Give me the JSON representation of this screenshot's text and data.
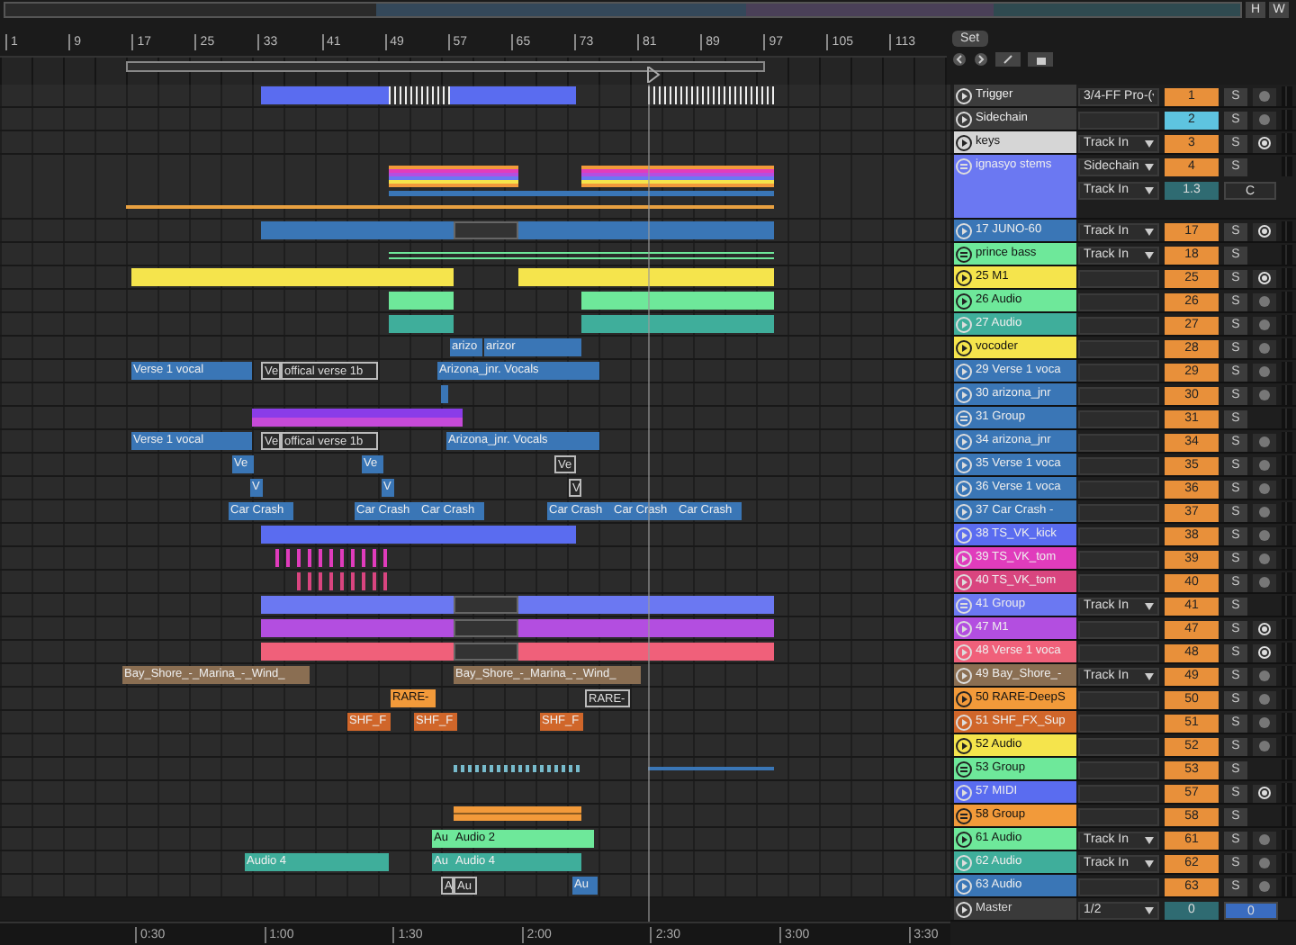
{
  "overview": {
    "buttons": [
      "H",
      "W"
    ]
  },
  "ruler": {
    "bars": [
      "1",
      "9",
      "17",
      "25",
      "33",
      "41",
      "49",
      "57",
      "65",
      "73",
      "81",
      "89",
      "97",
      "105",
      "113"
    ],
    "times": [
      "0:30",
      "1:00",
      "1:30",
      "2:00",
      "2:30",
      "3:00",
      "3:30"
    ]
  },
  "scene": {
    "button": "Set"
  },
  "tracks": [
    {
      "name": "Trigger",
      "kind": "track",
      "color": "#3c3c3c",
      "input": "3/4-FF Pro-(",
      "number": "1",
      "selected": false,
      "armed": false
    },
    {
      "name": "Sidechain",
      "kind": "track",
      "color": "#3c3c3c",
      "number": "2",
      "selected": true,
      "armed": false
    },
    {
      "name": "keys",
      "kind": "track",
      "color": "#d6d6d6",
      "input": "Track In",
      "number": "3",
      "selected": false,
      "armed": true
    },
    {
      "name": "ignasyo stems",
      "kind": "stems",
      "color": "#6b78f2",
      "input": "Sidechain",
      "number": "4",
      "selected": false,
      "sub_input": "Track In",
      "sub_value": "1.3",
      "sub_pan": "C"
    },
    {
      "name": "17 JUNO-60",
      "kind": "track",
      "color": "#3a76b6",
      "input": "Track In",
      "number": "17",
      "selected": false,
      "armed": true
    },
    {
      "name": "prince bass",
      "kind": "group",
      "color": "#6ee89a",
      "input": "Track In",
      "number": "18",
      "selected": false
    },
    {
      "name": "25 M1",
      "kind": "track",
      "color": "#f5e44c",
      "number": "25",
      "selected": false,
      "armed": true
    },
    {
      "name": "26 Audio",
      "kind": "track",
      "color": "#6ee89a",
      "number": "26",
      "selected": false,
      "armed": false
    },
    {
      "name": "27 Audio",
      "kind": "track",
      "color": "#3fae9b",
      "number": "27",
      "selected": false,
      "armed": false
    },
    {
      "name": "vocoder",
      "kind": "track",
      "color": "#f5e44c",
      "number": "28",
      "selected": false,
      "armed": false,
      "clips": [
        {
          "label": "arizo",
          "muted": false
        },
        {
          "label": "arizor",
          "muted": false
        }
      ]
    },
    {
      "name": "29 Verse 1 voca",
      "kind": "track",
      "color": "#3a76b6",
      "number": "29",
      "selected": false,
      "armed": false,
      "clips": [
        {
          "label": "Verse 1 vocal",
          "muted": false
        },
        {
          "label": "Ve",
          "muted": true
        },
        {
          "label": "offical verse 1b",
          "muted": true
        },
        {
          "label": "Arizona_jnr. Vocals",
          "muted": false
        }
      ]
    },
    {
      "name": "30 arizona_jnr",
      "kind": "track",
      "color": "#3a76b6",
      "number": "30",
      "selected": false,
      "armed": false
    },
    {
      "name": "31 Group",
      "kind": "group",
      "color": "#3a76b6",
      "number": "31",
      "selected": false
    },
    {
      "name": "34 arizona_jnr",
      "kind": "track",
      "color": "#3a76b6",
      "number": "34",
      "selected": false,
      "armed": false,
      "clips": [
        {
          "label": "Verse 1 vocal",
          "muted": false
        },
        {
          "label": "Ve",
          "muted": true
        },
        {
          "label": "offical verse 1b",
          "muted": true
        },
        {
          "label": "Arizona_jnr. Vocals",
          "muted": false
        }
      ]
    },
    {
      "name": "35 Verse 1 voca",
      "kind": "track",
      "color": "#3a76b6",
      "number": "35",
      "selected": false,
      "armed": false,
      "clips": [
        {
          "label": "Ve",
          "muted": false
        },
        {
          "label": "Ve",
          "muted": false
        },
        {
          "label": "Ve",
          "muted": true
        }
      ]
    },
    {
      "name": "36 Verse 1 voca",
      "kind": "track",
      "color": "#3a76b6",
      "number": "36",
      "selected": false,
      "armed": false,
      "clips": [
        {
          "label": "V",
          "muted": false
        },
        {
          "label": "V",
          "muted": false
        },
        {
          "label": "V",
          "muted": true
        }
      ]
    },
    {
      "name": "37 Car Crash -",
      "kind": "track",
      "color": "#3a76b6",
      "number": "37",
      "selected": false,
      "armed": false,
      "clips": [
        {
          "label": "Car Crash",
          "muted": false
        },
        {
          "label": "Car Crash",
          "muted": false
        },
        {
          "label": "Car Crash",
          "muted": false
        },
        {
          "label": "Car Crash",
          "muted": false
        },
        {
          "label": "Car Crash",
          "muted": false
        },
        {
          "label": "Car Crash",
          "muted": false
        }
      ]
    },
    {
      "name": "38 TS_VK_kick",
      "kind": "track",
      "color": "#5a6cf0",
      "number": "38",
      "selected": false,
      "armed": false
    },
    {
      "name": "39 TS_VK_tom",
      "kind": "track",
      "color": "#e03cbc",
      "number": "39",
      "selected": false,
      "armed": false
    },
    {
      "name": "40 TS_VK_tom",
      "kind": "track",
      "color": "#d9457f",
      "number": "40",
      "selected": false,
      "armed": false
    },
    {
      "name": "41 Group",
      "kind": "group",
      "color": "#6b78f2",
      "input": "Track In",
      "number": "41",
      "selected": false
    },
    {
      "name": "47 M1",
      "kind": "track",
      "color": "#b34ee0",
      "number": "47",
      "selected": false,
      "armed": true
    },
    {
      "name": "48 Verse 1 voca",
      "kind": "track",
      "color": "#f0607a",
      "number": "48",
      "selected": false,
      "armed": true
    },
    {
      "name": "49 Bay_Shore_-",
      "kind": "track",
      "color": "#8a6e52",
      "input": "Track In",
      "number": "49",
      "selected": false,
      "armed": false,
      "clips": [
        {
          "label": "Bay_Shore_-_Marina_-_Wind_",
          "muted": false
        },
        {
          "label": "Bay_Shore_-_Marina_-_Wind_",
          "muted": false
        }
      ]
    },
    {
      "name": "50 RARE-DeepS",
      "kind": "track",
      "color": "#f29a3a",
      "number": "50",
      "selected": false,
      "armed": false,
      "clips": [
        {
          "label": "RARE-",
          "muted": false
        },
        {
          "label": "RARE-",
          "muted": true
        }
      ]
    },
    {
      "name": "51 SHF_FX_Sup",
      "kind": "track",
      "color": "#d0662a",
      "number": "51",
      "selected": false,
      "armed": false,
      "clips": [
        {
          "label": "SHF_F",
          "muted": false
        },
        {
          "label": "SHF_F",
          "muted": false
        },
        {
          "label": "SHF_F",
          "muted": false
        }
      ]
    },
    {
      "name": "52 Audio",
      "kind": "track",
      "color": "#f5e44c",
      "number": "52",
      "selected": false,
      "armed": false
    },
    {
      "name": "53 Group",
      "kind": "group",
      "color": "#6ee89a",
      "number": "53",
      "selected": false
    },
    {
      "name": "57 MIDI",
      "kind": "track",
      "color": "#5a6cf0",
      "number": "57",
      "selected": false,
      "armed": true
    },
    {
      "name": "58 Group",
      "kind": "group",
      "color": "#f29a3a",
      "number": "58",
      "selected": false
    },
    {
      "name": "61 Audio",
      "kind": "track",
      "color": "#6ee89a",
      "input": "Track In",
      "number": "61",
      "selected": false,
      "armed": false,
      "clips": [
        {
          "label": "Au",
          "muted": false
        },
        {
          "label": "Audio 2",
          "muted": false
        }
      ]
    },
    {
      "name": "62 Audio",
      "kind": "track",
      "color": "#3fae9b",
      "input": "Track In",
      "number": "62",
      "selected": false,
      "armed": false,
      "clips": [
        {
          "label": "Audio 4",
          "muted": false
        },
        {
          "label": "Au",
          "muted": false
        },
        {
          "label": "Audio 4",
          "muted": false
        }
      ]
    },
    {
      "name": "63 Audio",
      "kind": "track",
      "color": "#3a76b6",
      "number": "63",
      "selected": false,
      "armed": false,
      "clips": [
        {
          "label": "A",
          "muted": true
        },
        {
          "label": "Au",
          "muted": true
        },
        {
          "label": "Au",
          "muted": false
        }
      ]
    }
  ],
  "solo_buttons": [
    "S",
    "S",
    "S",
    "S",
    "S",
    "S",
    "S",
    "S",
    "S",
    "S",
    "S",
    "S",
    "S",
    "S",
    "S",
    "S",
    "S",
    "S",
    "S",
    "S",
    "S",
    "S",
    "S",
    "S",
    "S",
    "S",
    "S",
    "S",
    "S",
    "S",
    "S",
    "S",
    "S"
  ],
  "master": {
    "name": "Master",
    "input": "1/2",
    "values": [
      "0",
      "0"
    ]
  }
}
